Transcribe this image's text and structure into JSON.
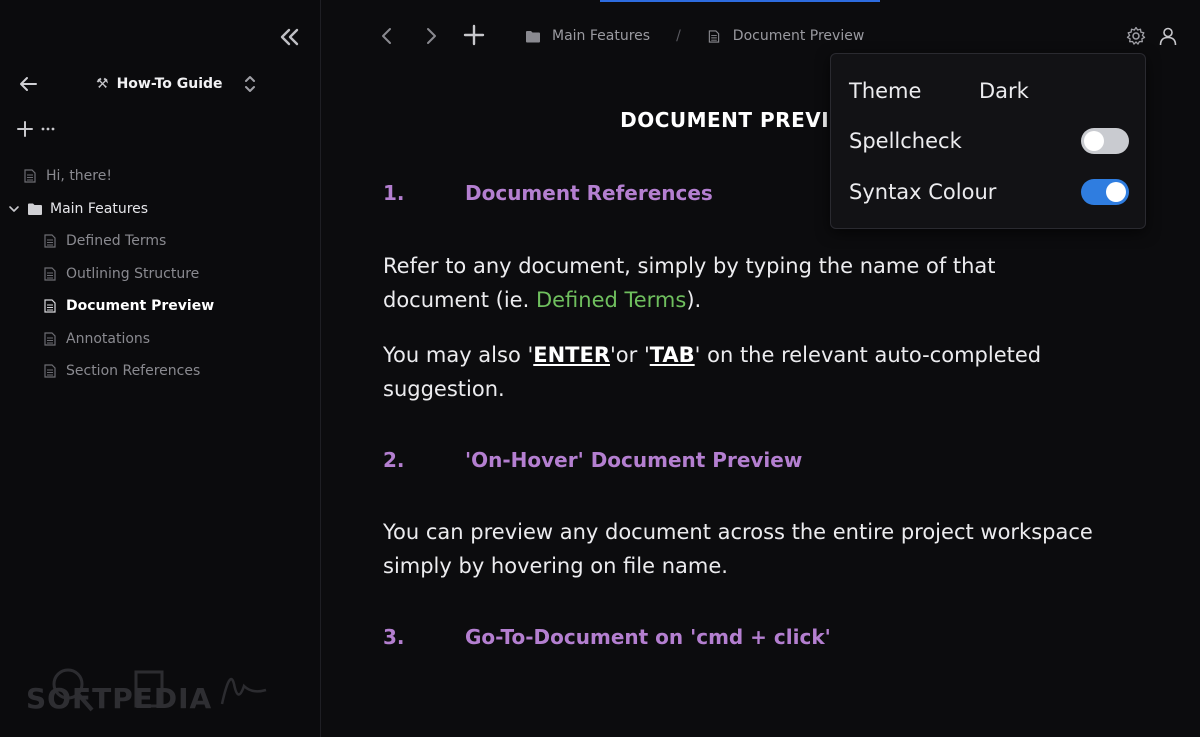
{
  "sidebar": {
    "guide_title": "How-To Guide",
    "tree": {
      "item0": "Hi, there!",
      "folder": "Main Features",
      "children": [
        "Defined Terms",
        "Outlining Structure",
        "Document Preview",
        "Annotations",
        "Section References"
      ]
    },
    "watermark": "SOFTPEDIA"
  },
  "topbar": {
    "breadcrumb": [
      "Main Features",
      "Document Preview"
    ],
    "separator": "/"
  },
  "document": {
    "title": "DOCUMENT PREVIEW",
    "sections": [
      {
        "number": "1.",
        "heading": "Document References"
      },
      {
        "number": "2.",
        "heading": "'On-Hover' Document Preview"
      },
      {
        "number": "3.",
        "heading": "Go-To-Document on 'cmd + click'"
      }
    ],
    "p1_before": "Refer to any document, simply by typing the name of that document (ie. ",
    "p1_link": "Defined Terms",
    "p1_after": ").",
    "p2_a": "You may also '",
    "p2_enter": "ENTER",
    "p2_b": "'or '",
    "p2_tab": "TAB",
    "p2_c": "' on the relevant auto-completed suggestion.",
    "p3": "You can preview any document across the entire project workspace simply by hovering on file name."
  },
  "settings": {
    "theme_label": "Theme",
    "theme_value": "Dark",
    "spellcheck_label": "Spellcheck",
    "spellcheck_on": false,
    "syntax_label": "Syntax Colour",
    "syntax_on": true
  },
  "colors": {
    "heading": "#b47fd0",
    "link": "#6fbf5e",
    "toggle_on": "#2f7de0",
    "toggle_off": "#c9cbd0"
  }
}
